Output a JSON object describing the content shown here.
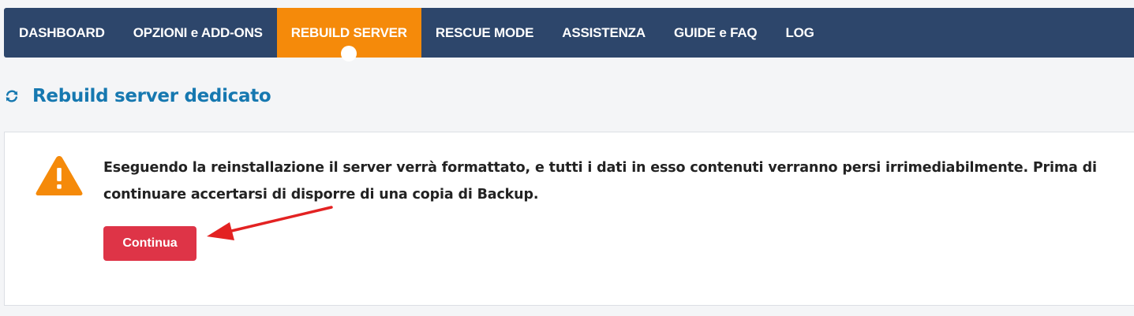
{
  "nav": {
    "items": [
      {
        "label": "DASHBOARD",
        "active": false
      },
      {
        "label": "OPZIONI e ADD-ONS",
        "active": false
      },
      {
        "label": "REBUILD SERVER",
        "active": true
      },
      {
        "label": "RESCUE MODE",
        "active": false
      },
      {
        "label": "ASSISTENZA",
        "active": false
      },
      {
        "label": "GUIDE e FAQ",
        "active": false
      },
      {
        "label": "LOG",
        "active": false
      }
    ]
  },
  "heading": {
    "icon": "refresh-icon",
    "title": "Rebuild server dedicato"
  },
  "warning": {
    "icon": "warning-triangle-icon",
    "message": "Eseguendo la reinstallazione il server verrà formattato, e tutti i dati in esso contenuti verranno persi irrimediabilmente. Prima di continuare accertarsi di disporre di una copia di Backup."
  },
  "actions": {
    "continue_label": "Continua"
  },
  "colors": {
    "nav_bg": "#2d466b",
    "nav_active": "#f58a0a",
    "title": "#1678b0",
    "warning": "#f58a0a",
    "button": "#de3447",
    "annotation_arrow": "#e32222"
  }
}
